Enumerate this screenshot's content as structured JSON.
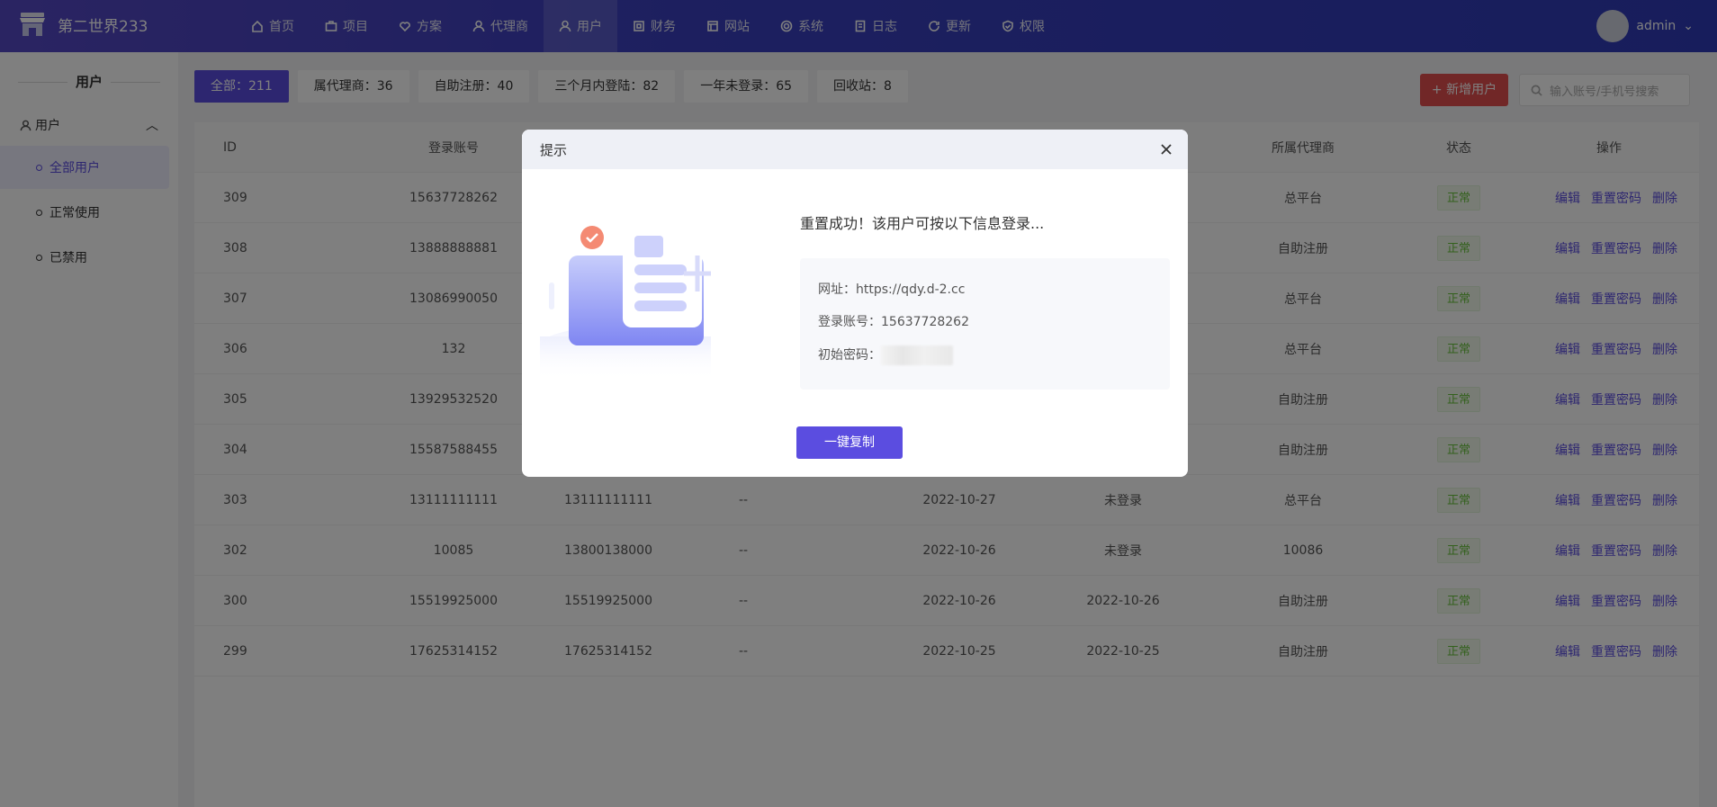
{
  "app": {
    "title": "第二世界233",
    "user": "admin"
  },
  "nav": [
    {
      "label": "首页",
      "icon": "home-icon"
    },
    {
      "label": "项目",
      "icon": "briefcase-icon"
    },
    {
      "label": "方案",
      "icon": "heart-icon"
    },
    {
      "label": "代理商",
      "icon": "person-icon"
    },
    {
      "label": "用户",
      "icon": "users-icon",
      "active": true
    },
    {
      "label": "财务",
      "icon": "finance-icon"
    },
    {
      "label": "网站",
      "icon": "layout-icon"
    },
    {
      "label": "系统",
      "icon": "gear-icon"
    },
    {
      "label": "日志",
      "icon": "document-icon"
    },
    {
      "label": "更新",
      "icon": "refresh-icon"
    },
    {
      "label": "权限",
      "icon": "shield-icon"
    }
  ],
  "sidebar": {
    "title": "用户",
    "group": "用户",
    "items": [
      {
        "label": "全部用户",
        "active": true
      },
      {
        "label": "正常使用"
      },
      {
        "label": "已禁用"
      }
    ]
  },
  "filters": [
    "全部：211",
    "属代理商：36",
    "自助注册：40",
    "三个月内登陆：82",
    "一年未登录：65",
    "回收站：8"
  ],
  "toolbar": {
    "add_label": "+ 新增用户",
    "search_placeholder": "输入账号/手机号搜索"
  },
  "table": {
    "headers": {
      "id": "ID",
      "account": "登录账号",
      "agent": "所属代理商",
      "status": "状态",
      "ops": "操作"
    },
    "rows": [
      {
        "id": "309",
        "account": "15637728262",
        "c3": "",
        "c4": "",
        "c5": "",
        "c6": "",
        "agent": "总平台",
        "status": "正常"
      },
      {
        "id": "308",
        "account": "13888888881",
        "c3": "",
        "c4": "",
        "c5": "",
        "c6": "",
        "agent": "自助注册",
        "status": "正常"
      },
      {
        "id": "307",
        "account": "13086990050",
        "c3": "",
        "c4": "",
        "c5": "",
        "c6": "",
        "agent": "总平台",
        "status": "正常"
      },
      {
        "id": "306",
        "account": "132",
        "c3": "",
        "c4": "",
        "c5": "",
        "c6": "",
        "agent": "总平台",
        "status": "正常"
      },
      {
        "id": "305",
        "account": "13929532520",
        "c3": "",
        "c4": "",
        "c5": "",
        "c6": "",
        "agent": "自助注册",
        "status": "正常"
      },
      {
        "id": "304",
        "account": "15587588455",
        "c3": "",
        "c4": "",
        "c5": "",
        "c6": "",
        "agent": "自助注册",
        "status": "正常"
      },
      {
        "id": "303",
        "account": "13111111111",
        "c3": "13111111111",
        "c4": "--",
        "c5": "2022-10-27",
        "c6": "未登录",
        "agent": "总平台",
        "status": "正常"
      },
      {
        "id": "302",
        "account": "10085",
        "c3": "13800138000",
        "c4": "--",
        "c5": "2022-10-26",
        "c6": "未登录",
        "agent": "10086",
        "status": "正常"
      },
      {
        "id": "300",
        "account": "15519925000",
        "c3": "15519925000",
        "c4": "--",
        "c5": "2022-10-26",
        "c6": "2022-10-26",
        "agent": "自助注册",
        "status": "正常"
      },
      {
        "id": "299",
        "account": "17625314152",
        "c3": "17625314152",
        "c4": "--",
        "c5": "2022-10-25",
        "c6": "2022-10-25",
        "agent": "自助注册",
        "status": "正常"
      }
    ],
    "ops": {
      "edit": "编辑",
      "reset": "重置密码",
      "delete": "删除"
    }
  },
  "dialog": {
    "title": "提示",
    "message": "重置成功！该用户可按以下信息登录...",
    "url_label": "网址：https://qdy.d-2.cc",
    "account_label": "登录账号：15637728262",
    "password_label": "初始密码：",
    "copy_button": "一键复制"
  },
  "colors": {
    "primary": "#5b4de0",
    "danger": "#e34f4f",
    "success": "#67c23a"
  }
}
